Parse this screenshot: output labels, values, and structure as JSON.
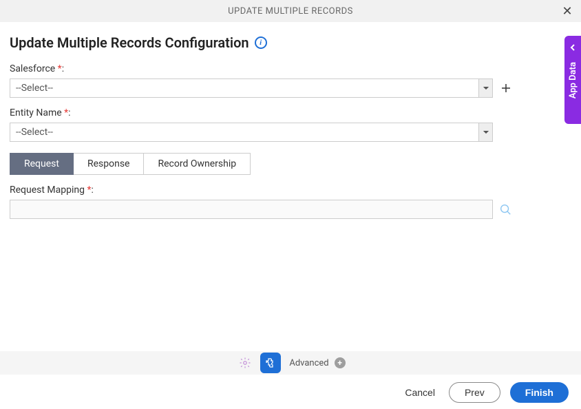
{
  "header": {
    "title": "UPDATE MULTIPLE RECORDS"
  },
  "page": {
    "title": "Update Multiple Records Configuration"
  },
  "fields": {
    "salesforce": {
      "label": "Salesforce",
      "value": "--Select--"
    },
    "entity": {
      "label": "Entity Name",
      "value": "--Select--"
    },
    "reqMapping": {
      "label": "Request Mapping",
      "value": ""
    }
  },
  "tabs": {
    "request": "Request",
    "response": "Response",
    "ownership": "Record Ownership"
  },
  "advBar": {
    "label": "Advanced"
  },
  "footer": {
    "cancel": "Cancel",
    "prev": "Prev",
    "finish": "Finish"
  },
  "sidePanel": {
    "label": "App Data"
  },
  "punct": {
    "colon": ":",
    "asterisk": " *"
  }
}
